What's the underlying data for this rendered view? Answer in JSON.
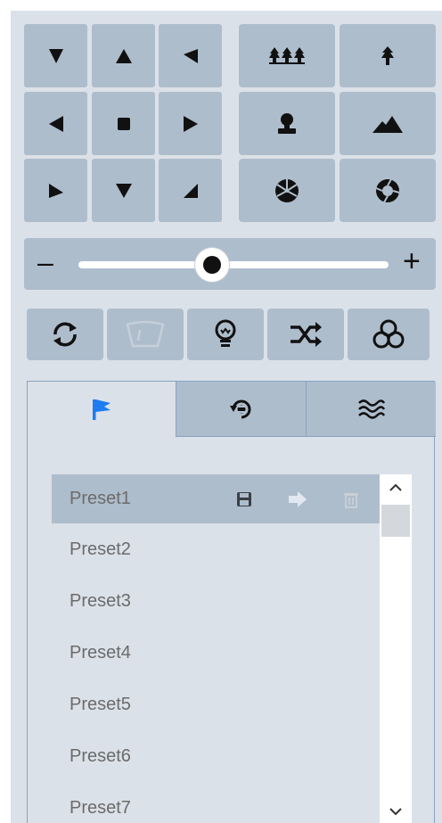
{
  "slider": {
    "minus_label": "–",
    "plus_label": "+",
    "zoom_fraction": 0.43
  },
  "ptz_grid": [
    {
      "name": "pan-up-left-button",
      "dir": "upleft"
    },
    {
      "name": "pan-up-button",
      "dir": "up"
    },
    {
      "name": "pan-up-right-button",
      "dir": "upright"
    },
    {
      "name": "pan-left-button",
      "dir": "left"
    },
    {
      "name": "ptz-stop-button",
      "dir": "stop"
    },
    {
      "name": "pan-right-button",
      "dir": "right"
    },
    {
      "name": "pan-down-left-button",
      "dir": "downleft"
    },
    {
      "name": "pan-down-button",
      "dir": "down"
    },
    {
      "name": "pan-down-right-button",
      "dir": "downright"
    }
  ],
  "lens_buttons": [
    {
      "name": "zoom-out-trees-button",
      "icon": "forest-icon"
    },
    {
      "name": "zoom-in-tree-button",
      "icon": "tree-icon"
    },
    {
      "name": "focus-near-button",
      "icon": "person-icon"
    },
    {
      "name": "focus-far-button",
      "icon": "mountain-icon"
    },
    {
      "name": "iris-close-button",
      "icon": "aperture-closed-icon"
    },
    {
      "name": "iris-open-button",
      "icon": "aperture-open-icon"
    }
  ],
  "toolbar": [
    {
      "name": "auto-scan-button",
      "icon": "refresh-icon"
    },
    {
      "name": "wiper-button",
      "icon": "wiper-icon"
    },
    {
      "name": "light-button",
      "icon": "bulb-icon"
    },
    {
      "name": "random-scan-button",
      "icon": "shuffle-icon"
    },
    {
      "name": "group-button",
      "icon": "link-rings-icon"
    }
  ],
  "tabs": [
    {
      "name": "tab-presets",
      "icon": "flag-icon",
      "active": true
    },
    {
      "name": "tab-patrol",
      "icon": "patrol-icon",
      "active": false
    },
    {
      "name": "tab-pattern",
      "icon": "wave-icon",
      "active": false
    }
  ],
  "presets": [
    {
      "label": "Preset1",
      "selected": true
    },
    {
      "label": "Preset2",
      "selected": false
    },
    {
      "label": "Preset3",
      "selected": false
    },
    {
      "label": "Preset4",
      "selected": false
    },
    {
      "label": "Preset5",
      "selected": false
    },
    {
      "label": "Preset6",
      "selected": false
    },
    {
      "label": "Preset7",
      "selected": false
    }
  ],
  "preset_actions": [
    {
      "name": "save-preset-button",
      "icon": "save-icon"
    },
    {
      "name": "call-preset-button",
      "icon": "arrow-right-icon"
    },
    {
      "name": "delete-preset-button",
      "icon": "trash-icon"
    }
  ],
  "colors": {
    "panel": "#dbe1e8",
    "button": "#aebdcc",
    "icon": "#111111",
    "accent": "#1e7cf0",
    "tab_border": "#8aa3c4"
  }
}
